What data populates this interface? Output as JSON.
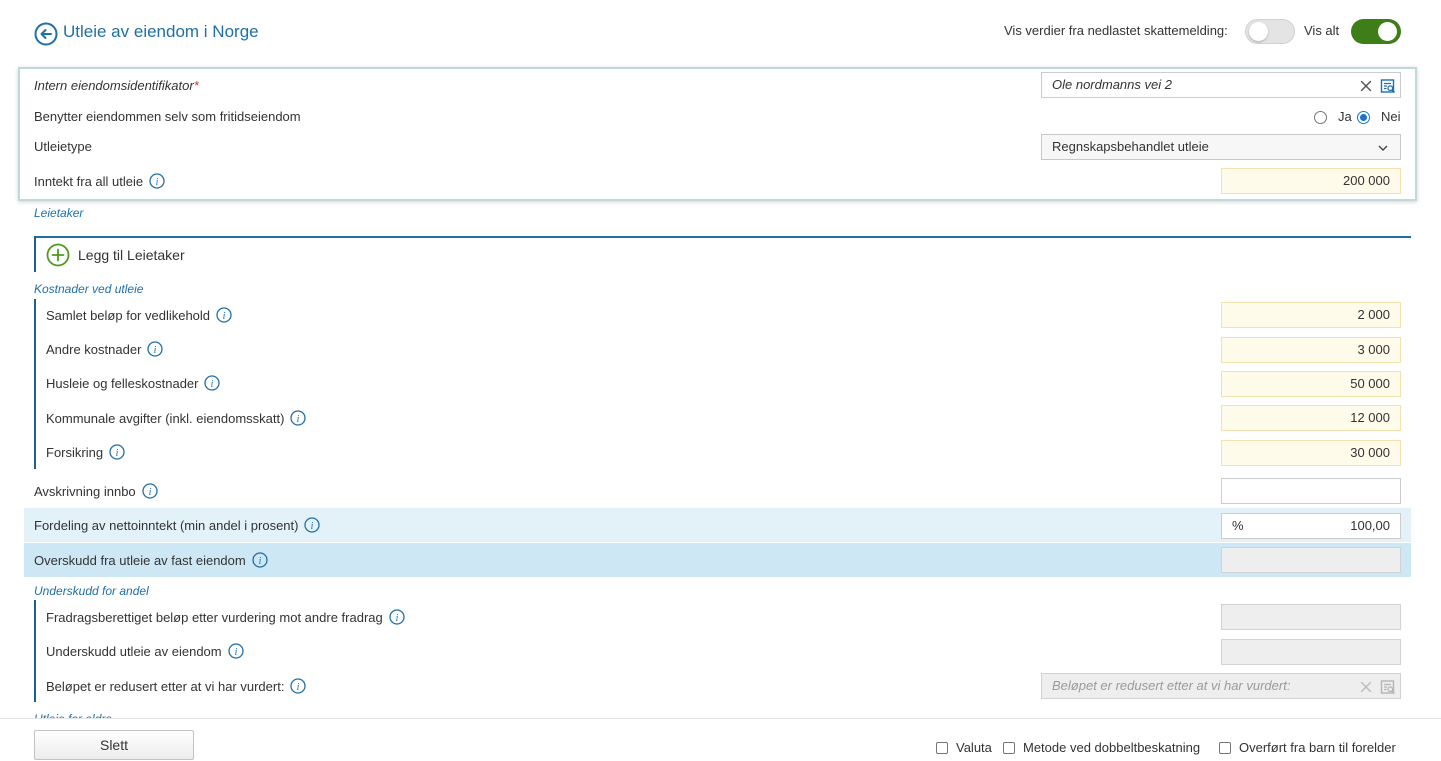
{
  "header": {
    "title": "Utleie av eiendom i Norge",
    "show_downloaded_label": "Vis verdier fra nedlastet skattemelding:",
    "show_all_label": "Vis alt"
  },
  "property": {
    "id_label": "Intern eiendomsidentifikator",
    "id_required_mark": "*",
    "id_value": "Ole nordmanns vei 2",
    "holiday_label": "Benytter eiendommen selv som fritidseiendom",
    "holiday_yes": "Ja",
    "holiday_no": "Nei",
    "type_label": "Utleietype",
    "type_value": "Regnskapsbehandlet utleie",
    "income_label": "Inntekt fra all utleie",
    "income_value": "200 000"
  },
  "tenants": {
    "section_title": "Leietaker",
    "add_label": "Legg til Leietaker"
  },
  "costs": {
    "section_title": "Kostnader ved utleie",
    "items": [
      {
        "label": "Samlet beløp for vedlikehold",
        "value": "2 000"
      },
      {
        "label": "Andre kostnader",
        "value": "3 000"
      },
      {
        "label": "Husleie og felleskostnader",
        "value": "50 000"
      },
      {
        "label": "Kommunale avgifter (inkl. eiendomsskatt)",
        "value": "12 000"
      },
      {
        "label": "Forsikring",
        "value": "30 000"
      }
    ]
  },
  "depreciation": {
    "label": "Avskrivning innbo",
    "value": ""
  },
  "distribution": {
    "label": "Fordeling av nettoinntekt (min andel i prosent)",
    "unit": "%",
    "value": "100,00"
  },
  "surplus": {
    "label": "Overskudd fra utleie av fast eiendom",
    "value": ""
  },
  "deficit": {
    "section_title": "Underskudd for andel",
    "items": [
      {
        "label": "Fradragsberettiget beløp etter vurdering mot andre fradrag",
        "value": ""
      },
      {
        "label": "Underskudd utleie av eiendom",
        "value": ""
      }
    ],
    "reduced_label": "Beløpet er redusert etter at vi har vurdert:",
    "reduced_placeholder": "Beløpet er redusert etter at vi har vurdert:"
  },
  "footer": {
    "delete_label": "Slett",
    "currency_label": "Valuta",
    "double_tax_label": "Metode ved dobbeltbeskatning",
    "transfer_label": "Overført fra barn til forelder",
    "cut_section": "Utleie for eldre"
  },
  "colors": {
    "accent": "#1f6fa8",
    "toggle_on": "#3f7d18",
    "add_icon": "#4f9a1e",
    "highlight_field": "#fffbea"
  },
  "icons": {
    "back": "arrow-left-circle-icon",
    "info": "info-icon",
    "clear": "close-icon",
    "lookup": "search-list-icon",
    "dropdown": "chevron-down-icon",
    "add": "plus-circle-icon"
  }
}
